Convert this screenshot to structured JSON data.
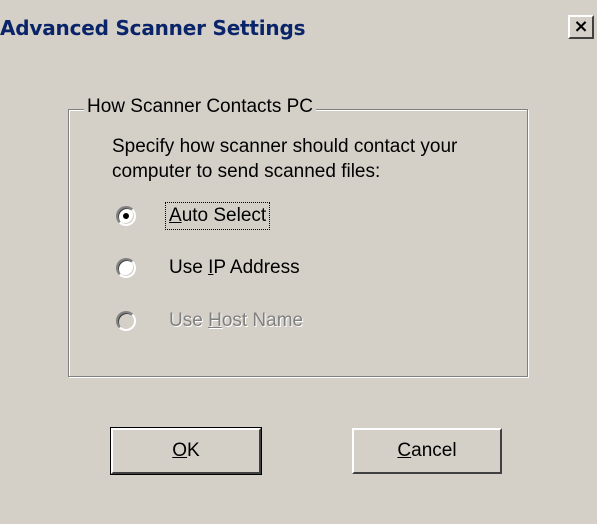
{
  "dialog": {
    "title": "Advanced Scanner Settings",
    "close_glyph": "×",
    "close_icon": "close-icon"
  },
  "group": {
    "legend": "How Scanner Contacts PC",
    "description": "Specify how scanner should contact your computer to send scanned files:"
  },
  "options": [
    {
      "pre": "",
      "accel": "A",
      "post": "uto Select",
      "selected": true,
      "enabled": true,
      "focused": true
    },
    {
      "pre": "Use ",
      "accel": "I",
      "post": "P Address",
      "selected": false,
      "enabled": true,
      "focused": false
    },
    {
      "pre": "Use ",
      "accel": "H",
      "post": "ost Name",
      "selected": false,
      "enabled": false,
      "focused": false
    }
  ],
  "buttons": {
    "ok": {
      "accel": "O",
      "rest": "K",
      "default": true
    },
    "cancel": {
      "accel": "C",
      "rest": "ancel",
      "default": false
    }
  },
  "colors": {
    "dialog_bg": "#d4d0c8",
    "title_text": "#0a246a",
    "disabled_text": "#808080"
  }
}
